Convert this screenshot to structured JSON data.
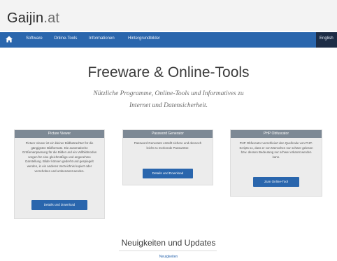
{
  "brand": {
    "name": "Gaijin",
    "tld": ".at"
  },
  "nav": {
    "items": [
      "Software",
      "Online-Tools",
      "Informationen",
      "Hintergrundbilder"
    ],
    "language": "English"
  },
  "hero": {
    "title": "Freeware & Online-Tools",
    "subtitle": "Nützliche Programme, Online-Tools und Informatives zu Internet und Datensicherheit."
  },
  "cards": [
    {
      "title": "Picture Viewer",
      "text": "Picture Viewer ist ein kleiner Bildbetrachter für die gängigsten Bildformate. Die automatische Größenanpassung für die Bilder und ein Vollbildmodus sorgen für eine gleichmäßige und angenehme Darstellung. Bilder können gedreht und gespiegelt werden, in ein anderes Verzeichnis kopiert oder verschoben und umbenannt werden.",
      "button": "Details und Download"
    },
    {
      "title": "Password Generator",
      "text": "Password Generator erstellt sichere und dennoch leicht zu merkende Passwörter.",
      "button": "Details und Download"
    },
    {
      "title": "PHP Obfuscator",
      "text": "PHP Obfuscator verschleiert den Quellcode von PHP-Scripts so, dass er von Menschen nur schwer gelesen bzw. dessen Bedeutung nur schwer erkannt werden kann.",
      "button": "Zum Online-Tool"
    }
  ],
  "news": {
    "title": "Neuigkeiten und Updates",
    "link": "Neuigkeiten"
  },
  "colors": {
    "nav": "#2a66ad",
    "card_header": "#7d8995",
    "button": "#2a66ad"
  }
}
